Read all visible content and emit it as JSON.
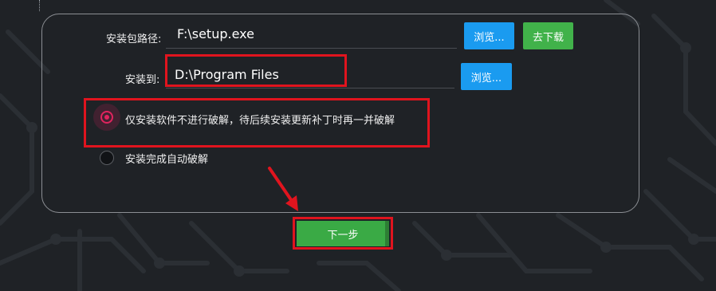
{
  "form": {
    "package_path_label": "安装包路径:",
    "package_path_value": "F:\\setup.exe",
    "browse_label": "浏览...",
    "download_label": "去下载",
    "install_to_label": "安装到:",
    "install_to_value": "D:\\Program Files",
    "browse2_label": "浏览..."
  },
  "options": [
    {
      "label": "仅安装软件不进行破解，待后续安装更新补丁时再一并破解",
      "selected": true
    },
    {
      "label": "安装完成自动破解",
      "selected": false
    }
  ],
  "next_label": "下一步",
  "colors": {
    "background": "#1f2226",
    "accent_blue": "#1a9bf0",
    "accent_green": "#41b24a",
    "radio_selected": "#e0245e",
    "highlight_red": "#e0141e"
  },
  "icons": [
    "red-arrow-annotation"
  ]
}
